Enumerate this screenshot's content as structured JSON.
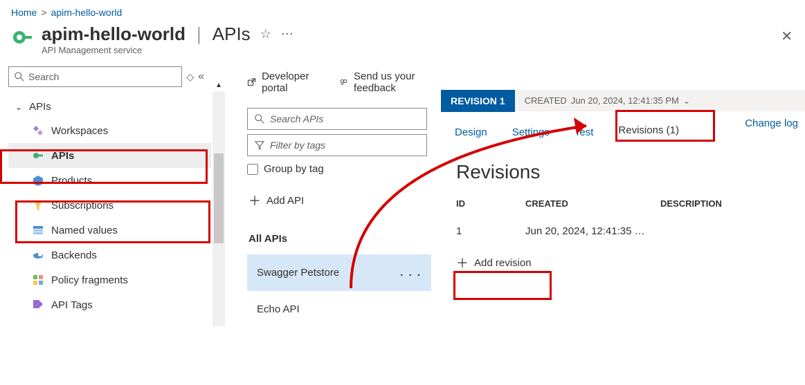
{
  "breadcrumb": {
    "home": "Home",
    "resource": "apim-hello-world"
  },
  "header": {
    "title": "apim-hello-world",
    "section": "APIs",
    "subtitle": "API Management service"
  },
  "sidebar": {
    "search_placeholder": "Search",
    "group_label": "APIs",
    "items": [
      {
        "label": "Workspaces"
      },
      {
        "label": "APIs"
      },
      {
        "label": "Products"
      },
      {
        "label": "Subscriptions"
      },
      {
        "label": "Named values"
      },
      {
        "label": "Backends"
      },
      {
        "label": "Policy fragments"
      },
      {
        "label": "API Tags"
      }
    ]
  },
  "toplinks": {
    "dev_portal": "Developer portal",
    "feedback": "Send us your feedback"
  },
  "mid": {
    "search_placeholder": "Search APIs",
    "filter_placeholder": "Filter by tags",
    "group_by_tag": "Group by tag",
    "add_api": "Add API",
    "all_apis": "All APIs",
    "apis": [
      {
        "name": "Swagger Petstore"
      },
      {
        "name": "Echo API"
      }
    ]
  },
  "right": {
    "rev_badge": "REVISION 1",
    "rev_created_label": "CREATED",
    "rev_created_value": "Jun 20, 2024, 12:41:35 PM",
    "tabs": {
      "design": "Design",
      "settings": "Settings",
      "test": "Test",
      "revisions": "Revisions (1)",
      "changelog": "Change log"
    },
    "section_title": "Revisions",
    "columns": {
      "id": "ID",
      "created": "CREATED",
      "description": "DESCRIPTION"
    },
    "rows": [
      {
        "id": "1",
        "created": "Jun 20, 2024, 12:41:35 …",
        "description": ""
      }
    ],
    "add_revision": "Add revision"
  }
}
